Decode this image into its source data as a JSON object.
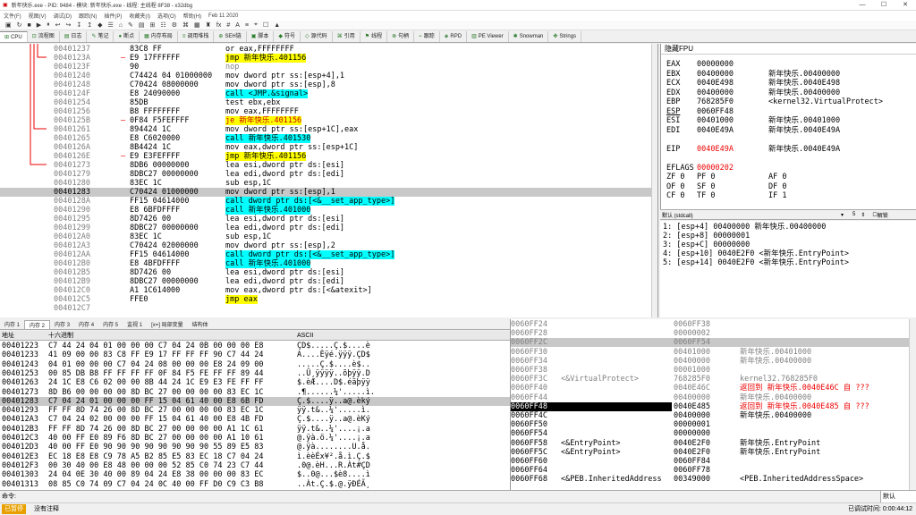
{
  "window": {
    "title": "新年快乐.exe - PID: 9484 - 模块: 新年快乐.exe - 线程: 主线程 8F38 - x32dbg"
  },
  "menu": [
    "文件(F)",
    "视图(V)",
    "调试(D)",
    "跟踪(N)",
    "插件(P)",
    "收藏夹(I)",
    "选项(O)",
    "帮助(H)",
    "Feb 11 2020"
  ],
  "toolbar": [
    "▣",
    "↻",
    "■",
    "▶",
    "⏸",
    "↩",
    "↪",
    "↧",
    "↥",
    "◆",
    "☰",
    "⌂",
    "✎",
    "▤",
    "⊞",
    "☷",
    "⚙",
    "⌘",
    "▦",
    "♜",
    "fx",
    "#",
    "A",
    "≡",
    "⌖",
    "☐",
    "▲"
  ],
  "tabs": [
    {
      "icon": "⊞",
      "label": "CPU"
    },
    {
      "icon": "⊡",
      "label": "流程图"
    },
    {
      "icon": "▤",
      "label": "日志"
    },
    {
      "icon": "✎",
      "label": "笔记"
    },
    {
      "icon": "●",
      "label": "断点"
    },
    {
      "icon": "▦",
      "label": "内存布局"
    },
    {
      "icon": "≡",
      "label": "调用堆栈"
    },
    {
      "icon": "⊕",
      "label": "SEH链"
    },
    {
      "icon": "▣",
      "label": "脚本"
    },
    {
      "icon": "◆",
      "label": "符号"
    },
    {
      "icon": "◇",
      "label": "源代码"
    },
    {
      "icon": "⌘",
      "label": "引用"
    },
    {
      "icon": "⚑",
      "label": "线程"
    },
    {
      "icon": "⊗",
      "label": "句柄"
    },
    {
      "icon": "⌁",
      "label": "跟踪"
    },
    {
      "icon": "◈",
      "label": "RPD"
    },
    {
      "icon": "▥",
      "label": "PE Viewer"
    },
    {
      "icon": "✱",
      "label": "Snowman"
    },
    {
      "icon": "✤",
      "label": "Strings"
    }
  ],
  "disasm": [
    {
      "addr": "00401237",
      "mark": "",
      "bytes": "83C8 FF",
      "instr": "or eax,FFFFFFFF",
      "hl": ""
    },
    {
      "addr": "0040123A",
      "mark": "–",
      "bytes": "E9 17FFFFFF",
      "instr": "jmp 新年快乐.401156",
      "hl": "jmp"
    },
    {
      "addr": "0040123F",
      "mark": "",
      "bytes": "90",
      "instr": "nop",
      "hl": "nop"
    },
    {
      "addr": "00401240",
      "mark": "",
      "bytes": "C74424 04 01000000",
      "instr": "mov dword ptr ss:[esp+4],1",
      "hl": ""
    },
    {
      "addr": "00401248",
      "mark": "",
      "bytes": "C70424 08000000",
      "instr": "mov dword ptr ss:[esp],8",
      "hl": ""
    },
    {
      "addr": "0040124F",
      "mark": "",
      "bytes": "E8 24090000",
      "instr": "call <JMP.&signal>",
      "hl": "call"
    },
    {
      "addr": "00401254",
      "mark": "",
      "bytes": "85DB",
      "instr": "test ebx,ebx",
      "hl": ""
    },
    {
      "addr": "00401256",
      "mark": "",
      "bytes": "B8 FFFFFFFF",
      "instr": "mov eax,FFFFFFFF",
      "hl": ""
    },
    {
      "addr": "0040125B",
      "mark": "–",
      "bytes": "0F84 F5FEFFFF",
      "instr": "je 新年快乐.401156",
      "hl": "jcc"
    },
    {
      "addr": "00401261",
      "mark": "",
      "bytes": "894424 1C",
      "instr": "mov dword ptr ss:[esp+1C],eax",
      "hl": ""
    },
    {
      "addr": "00401265",
      "mark": "",
      "bytes": "E8 C6020000",
      "instr": "call 新年快乐.401530",
      "hl": "call"
    },
    {
      "addr": "0040126A",
      "mark": "",
      "bytes": "8B4424 1C",
      "instr": "mov eax,dword ptr ss:[esp+1C]",
      "hl": ""
    },
    {
      "addr": "0040126E",
      "mark": "–",
      "bytes": "E9 E3FEFFFF",
      "instr": "jmp 新年快乐.401156",
      "hl": "jmp"
    },
    {
      "addr": "00401273",
      "mark": "",
      "bytes": "8DB6 00000000",
      "instr": "lea esi,dword ptr ds:[esi]",
      "hl": ""
    },
    {
      "addr": "00401279",
      "mark": "",
      "bytes": "8DBC27 00000000",
      "instr": "lea edi,dword ptr ds:[edi]",
      "hl": ""
    },
    {
      "addr": "00401280",
      "mark": "",
      "bytes": "83EC 1C",
      "instr": "sub esp,1C",
      "hl": ""
    },
    {
      "addr": "00401283",
      "mark": "",
      "bytes": "C70424 01000000",
      "instr": "mov dword ptr ss:[esp],1",
      "hl": "",
      "sel": true
    },
    {
      "addr": "0040128A",
      "mark": "",
      "bytes": "FF15 04614000",
      "instr": "call dword ptr ds:[<&__set_app_type>]",
      "hl": "call"
    },
    {
      "addr": "00401290",
      "mark": "",
      "bytes": "E8 6BFDFFFF",
      "instr": "call 新年快乐.401000",
      "hl": "call"
    },
    {
      "addr": "00401295",
      "mark": "",
      "bytes": "8D7426 00",
      "instr": "lea esi,dword ptr ds:[esi]",
      "hl": ""
    },
    {
      "addr": "00401299",
      "mark": "",
      "bytes": "8DBC27 00000000",
      "instr": "lea edi,dword ptr ds:[edi]",
      "hl": ""
    },
    {
      "addr": "004012A0",
      "mark": "",
      "bytes": "83EC 1C",
      "instr": "sub esp,1C",
      "hl": ""
    },
    {
      "addr": "004012A3",
      "mark": "",
      "bytes": "C70424 02000000",
      "instr": "mov dword ptr ss:[esp],2",
      "hl": ""
    },
    {
      "addr": "004012AA",
      "mark": "",
      "bytes": "FF15 04614000",
      "instr": "call dword ptr ds:[<&__set_app_type>]",
      "hl": "call"
    },
    {
      "addr": "004012B0",
      "mark": "",
      "bytes": "E8 4BFDFFFF",
      "instr": "call 新年快乐.401000",
      "hl": "call"
    },
    {
      "addr": "004012B5",
      "mark": "",
      "bytes": "8D7426 00",
      "instr": "lea esi,dword ptr ds:[esi]",
      "hl": ""
    },
    {
      "addr": "004012B9",
      "mark": "",
      "bytes": "8DBC27 00000000",
      "instr": "lea edi,dword ptr ds:[edi]",
      "hl": ""
    },
    {
      "addr": "004012C0",
      "mark": "",
      "bytes": "A1 1C614000",
      "instr": "mov eax,dword ptr ds:[<&atexit>]",
      "hl": ""
    },
    {
      "addr": "004012C5",
      "mark": "",
      "bytes": "FFE0",
      "instr": "jmp eax",
      "hl": "jmp"
    },
    {
      "addr": "004012C7",
      "mark": "",
      "bytes": "",
      "instr": "",
      "hl": ""
    }
  ],
  "regs": {
    "title": "隐藏FPU",
    "rows": [
      {
        "name": "EAX",
        "value": "00000000",
        "info": ""
      },
      {
        "name": "EBX",
        "value": "00400000",
        "info": "新年快乐.00400000"
      },
      {
        "name": "ECX",
        "value": "0040E498",
        "info": "新年快乐.0040E498"
      },
      {
        "name": "EDX",
        "value": "00400000",
        "info": "新年快乐.00400000"
      },
      {
        "name": "EBP",
        "value": "768285F0",
        "info": "<kernel32.VirtualProtect>"
      },
      {
        "name": "ESP",
        "value": "0060FF48",
        "info": "",
        "underline": true
      },
      {
        "name": "ESI",
        "value": "00401000",
        "info": "新年快乐.00401000"
      },
      {
        "name": "EDI",
        "value": "0040E49A",
        "info": "新年快乐.0040E49A"
      },
      {
        "name": "",
        "value": "",
        "info": ""
      },
      {
        "name": "EIP",
        "value": "0040E49A",
        "info": "新年快乐.0040E49A",
        "red": true
      },
      {
        "name": "",
        "value": "",
        "info": ""
      },
      {
        "name": "EFLAGS",
        "value": "00000202",
        "info": "",
        "redval": true
      },
      {
        "name": "ZF 0",
        "value": "PF 0",
        "info": "AF 0"
      },
      {
        "name": "OF 0",
        "value": "SF 0",
        "info": "DF 0"
      },
      {
        "name": "CF 0",
        "value": "TF 0",
        "info": "IF 1"
      }
    ]
  },
  "regsbar": {
    "conv": "默认 (stdcall)",
    "count": "5",
    "unlock": "解锁"
  },
  "args": [
    "1: [esp+4] 00400000 新年快乐.00400000",
    "2: [esp+8] 00000001",
    "3: [esp+C] 00000000",
    "4: [esp+10] 0040E2F0 <新年快乐.EntryPoint>",
    "5: [esp+14] 0040E2F0 <新年快乐.EntryPoint>"
  ],
  "dumptabs": [
    "内存 1",
    "内存 2",
    "内存 3",
    "内存 4",
    "内存 5",
    "监视 1",
    "[x=] 局部变量",
    "结构体"
  ],
  "dump": {
    "headers": {
      "addr": "地址",
      "hex": "十六进制",
      "ascii": "ASCII"
    },
    "rows": [
      {
        "addr": "00401223",
        "hex": "C7 44 24 04 01 00 00 00 C7 04 24 0B 00 00 00 E8",
        "ascii": "ÇD$.....Ç.$....è"
      },
      {
        "addr": "00401233",
        "hex": "41 09 00 00 83 C8 FF E9 17 FF FF FF 90 C7 44 24",
        "ascii": "A....Èÿé.ÿÿÿ.ÇD$"
      },
      {
        "addr": "00401243",
        "hex": "04 01 00 00 00 C7 04 24 08 00 00 00 E8 24 09 00",
        "ascii": ".....Ç.$....è$.."
      },
      {
        "addr": "00401253",
        "hex": "00 85 DB B8 FF FF FF FF 0F 84 F5 FE FF FF 89 44",
        "ascii": "..Û¸ÿÿÿÿ..õþÿÿ.D"
      },
      {
        "addr": "00401263",
        "hex": "24 1C E8 C6 02 00 00 8B 44 24 1C E9 E3 FE FF FF",
        "ascii": "$.èÆ....D$.éãþÿÿ"
      },
      {
        "addr": "00401273",
        "hex": "8D B6 00 00 00 00 8D BC 27 00 00 00 00 83 EC 1C",
        "ascii": ".¶......¼'.....ì."
      },
      {
        "addr": "00401283",
        "hex": "C7 04 24 01 00 00 00 FF 15 04 61 40 00 E8 6B FD",
        "ascii": "Ç.$....ÿ..a@.èký",
        "sel": true
      },
      {
        "addr": "00401293",
        "hex": "FF FF 8D 74 26 00 8D BC 27 00 00 00 00 83 EC 1C",
        "ascii": "ÿÿ.t&..¼'.....ì."
      },
      {
        "addr": "004012A3",
        "hex": "C7 04 24 02 00 00 00 FF 15 04 61 40 00 E8 4B FD",
        "ascii": "Ç.$....ÿ..a@.èKý"
      },
      {
        "addr": "004012B3",
        "hex": "FF FF 8D 74 26 00 8D BC 27 00 00 00 00 A1 1C 61",
        "ascii": "ÿÿ.t&..¼'....¡.a"
      },
      {
        "addr": "004012C3",
        "hex": "40 00 FF E0 89 F6 8D BC 27 00 00 00 00 A1 10 61",
        "ascii": "@.ÿà.ö.¼'....¡.a"
      },
      {
        "addr": "004012D3",
        "hex": "40 00 FF E0 90 90 90 90 90 90 90 90 55 89 E5 83",
        "ascii": "@.ÿà........U.å."
      },
      {
        "addr": "004012E3",
        "hex": "EC 18 E8 E8 C9 78 A5 B2 85 E5 83 EC 18 C7 04 24",
        "ascii": "ì.èèÉx¥².å.ì.Ç.$"
      },
      {
        "addr": "004012F3",
        "hex": "00 30 40 00 E8 48 00 00 00 52 85 C0 74 23 C7 44",
        "ascii": ".0@.èH...R.Àt#ÇD"
      },
      {
        "addr": "00401303",
        "hex": "24 04 0E 30 40 00 89 04 24 E8 38 00 00 00 83 EC",
        "ascii": "$..0@...$è8....ì"
      },
      {
        "addr": "00401313",
        "hex": "08 85 C0 74 09 C7 04 24 0C 40 00 FF D0 C9 C3 B8",
        "ascii": "..Àt.Ç.$.@.ÿÐÉÃ¸"
      }
    ]
  },
  "stack": [
    {
      "addr": "0060FF24",
      "cmt": "",
      "val": "0060FF38",
      "info": ""
    },
    {
      "addr": "0060FF28",
      "cmt": "",
      "val": "00000002",
      "info": ""
    },
    {
      "addr": "0060FF2C",
      "cmt": "",
      "val": "0060FF54",
      "info": "",
      "gray": true
    },
    {
      "addr": "0060FF30",
      "cmt": "",
      "val": "00401000",
      "info": "新年快乐.00401000"
    },
    {
      "addr": "0060FF34",
      "cmt": "",
      "val": "00400000",
      "info": "新年快乐.00400000"
    },
    {
      "addr": "0060FF38",
      "cmt": "",
      "val": "00001000",
      "info": ""
    },
    {
      "addr": "0060FF3C",
      "cmt": "<&VirtualProtect>",
      "val": "768285F0",
      "info": "kernel32.768285F0"
    },
    {
      "addr": "0060FF40",
      "cmt": "",
      "val": "0040E46C",
      "info": "返回到 新年快乐.0040E46C 自 ???",
      "ret": true
    },
    {
      "addr": "0060FF44",
      "cmt": "",
      "val": "00400000",
      "info": "新年快乐.00400000"
    },
    {
      "addr": "0060FF48",
      "cmt": "",
      "val": "0040E485",
      "info": "返回到 新年快乐.0040E485 自 ???",
      "ret": true,
      "hi": true
    },
    {
      "addr": "0060FF4C",
      "cmt": "",
      "val": "00400000",
      "info": "新年快乐.00400000",
      "dark": true
    },
    {
      "addr": "0060FF50",
      "cmt": "",
      "val": "00000001",
      "info": "",
      "dark": true
    },
    {
      "addr": "0060FF54",
      "cmt": "",
      "val": "00000000",
      "info": "",
      "dark": true
    },
    {
      "addr": "0060FF58",
      "cmt": "<&EntryPoint>",
      "val": "0040E2F0",
      "info": "新年快乐.EntryPoint",
      "dark": true
    },
    {
      "addr": "0060FF5C",
      "cmt": "<&EntryPoint>",
      "val": "0040E2F0",
      "info": "新年快乐.EntryPoint",
      "dark": true
    },
    {
      "addr": "0060FF60",
      "cmt": "",
      "val": "0060FF84",
      "info": "",
      "dark": true
    },
    {
      "addr": "0060FF64",
      "cmt": "",
      "val": "0060FF78",
      "info": "",
      "dark": true
    },
    {
      "addr": "0060FF68",
      "cmt": "<&PEB.InheritedAddress",
      "val": "00349000",
      "info": "<PEB.InheritedAddressSpace>",
      "dark": true
    }
  ],
  "cmd": {
    "label": "命令:",
    "default": "默认"
  },
  "status": {
    "state": "已暂停",
    "msg": "没有注释",
    "time": "已调试时间: 0:00:44:12"
  }
}
